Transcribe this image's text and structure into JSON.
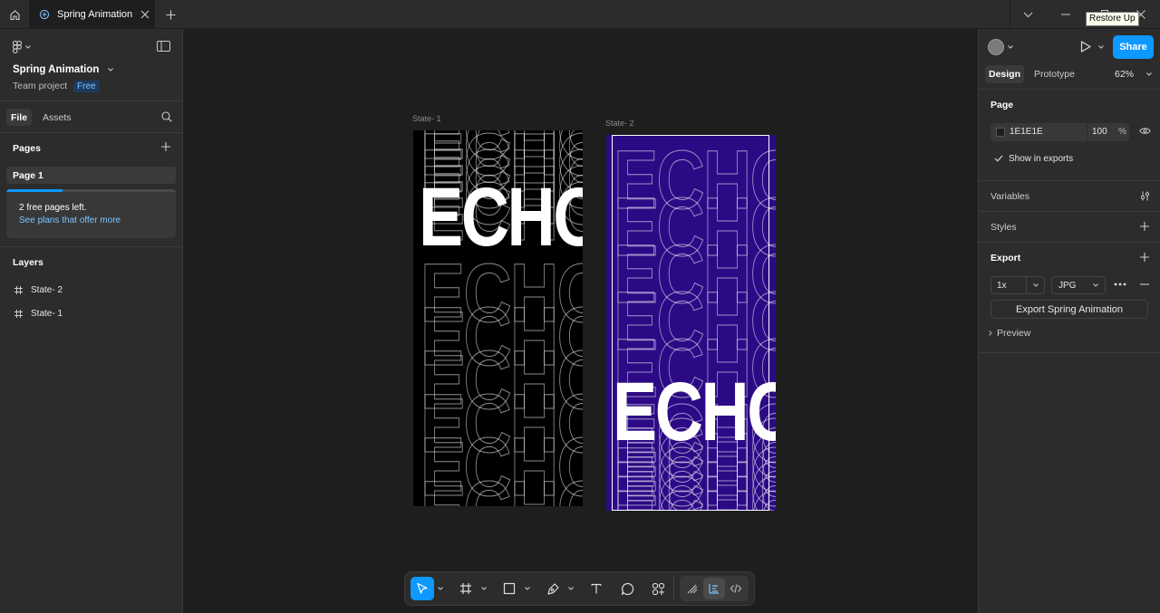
{
  "tabbar": {
    "tab_title": "Spring Animation",
    "tooltip": "Restore Up"
  },
  "leftpanel": {
    "file_name": "Spring Animation",
    "project": "Team project",
    "plan_badge": "Free",
    "tabs": {
      "file": "File",
      "assets": "Assets"
    },
    "pages_title": "Pages",
    "pages": [
      {
        "label": "Page 1"
      }
    ],
    "notice": {
      "text": "2 free pages left.",
      "link": "See plans that offer more",
      "progress": 0.33
    },
    "layers_title": "Layers",
    "layers": [
      {
        "label": "State- 2"
      },
      {
        "label": "State- 1"
      }
    ]
  },
  "canvas": {
    "frames": [
      {
        "label": "State- 1",
        "word": "ECHO",
        "background": "#000000"
      },
      {
        "label": "State- 2",
        "word": "ECHO",
        "background": "#2d0a85"
      }
    ]
  },
  "rightpanel": {
    "tabs": {
      "design": "Design",
      "prototype": "Prototype"
    },
    "zoom": "62%",
    "share_label": "Share",
    "page_section": "Page",
    "page_color": "1E1E1E",
    "page_opacity": "100",
    "opacity_unit": "%",
    "show_in_exports": "Show in exports",
    "variables": "Variables",
    "styles": "Styles",
    "export": "Export",
    "export_scale": "1x",
    "export_format": "JPG",
    "export_button": "Export Spring Animation",
    "preview": "Preview"
  },
  "help": "?",
  "colors": {
    "accent": "#0d99ff",
    "panel": "#2c2c2c",
    "canvas": "#1e1e1e",
    "purple": "#2d0a85"
  }
}
